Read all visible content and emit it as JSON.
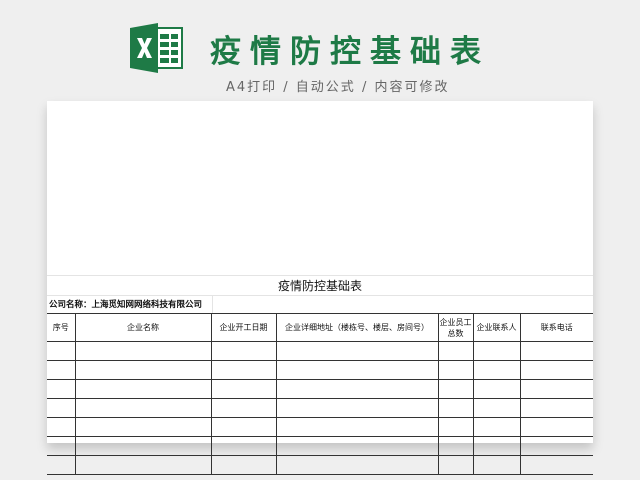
{
  "header": {
    "title": "疫情防控基础表",
    "subtitle": "A4打印 / 自动公式 / 内容可修改",
    "icon": "excel-icon",
    "brand_color": "#1e7a46"
  },
  "sheet": {
    "title": "疫情防控基础表",
    "company_label": "公司名称：上海觅知网网络科技有限公司",
    "columns": [
      "序号",
      "企业名称",
      "企业开工日期",
      "企业详细地址（楼栋号、楼层、房间号）",
      "企业员工总数",
      "企业联系人",
      "联系电话"
    ],
    "rows": [
      [
        "",
        "",
        "",
        "",
        "",
        "",
        ""
      ],
      [
        "",
        "",
        "",
        "",
        "",
        "",
        ""
      ],
      [
        "",
        "",
        "",
        "",
        "",
        "",
        ""
      ],
      [
        "",
        "",
        "",
        "",
        "",
        "",
        ""
      ],
      [
        "",
        "",
        "",
        "",
        "",
        "",
        ""
      ],
      [
        "",
        "",
        "",
        "",
        "",
        "",
        ""
      ],
      [
        "",
        "",
        "",
        "",
        "",
        "",
        ""
      ]
    ]
  }
}
